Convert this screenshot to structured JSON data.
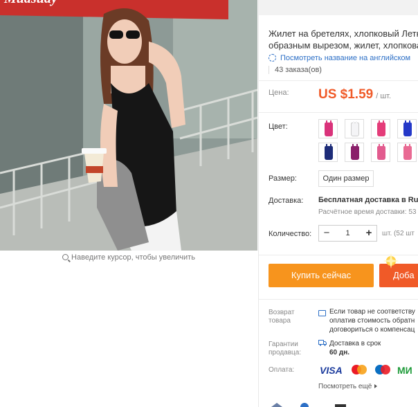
{
  "product_image": {
    "watermark": "Mudsuay",
    "zoom_hint": "Наведите курсор, чтобы увеличить"
  },
  "product": {
    "title_line1": "Жилет на бретелях, хлопковый Летн",
    "title_line2": "образным вырезом, жилет, хлопкова",
    "translate_link": "Посмотреть название на английском",
    "orders": "43 заказа(ов)"
  },
  "price": {
    "label": "Цена:",
    "value": "US $1.59",
    "unit": "/ шт."
  },
  "color": {
    "label": "Цвет:",
    "options": [
      {
        "name": "rose",
        "color": "#d9327a"
      },
      {
        "name": "white",
        "color": "#f4f4f6"
      },
      {
        "name": "pink-red",
        "color": "#e43c79"
      },
      {
        "name": "blue",
        "color": "#2438c8"
      },
      {
        "name": "navy",
        "color": "#1d2c78"
      },
      {
        "name": "purple",
        "color": "#8a1f6a"
      },
      {
        "name": "pink",
        "color": "#e25b8e"
      },
      {
        "name": "light-pink",
        "color": "#e96a93"
      }
    ]
  },
  "size": {
    "label": "Размер:",
    "value": "Один размер"
  },
  "shipping": {
    "label": "Доставка:",
    "free": "Бесплатная доставка в Russ",
    "time": "Расчётное время доставки: 53"
  },
  "quantity": {
    "label": "Количество:",
    "value": "1",
    "minus": "−",
    "plus": "+",
    "note": "шт. (52 шт"
  },
  "actions": {
    "buy_now": "Купить сейчас",
    "add_to_cart": "Доба"
  },
  "returns": {
    "label_line1": "Возврат",
    "label_line2": "товара",
    "text_line1": "Если товар не соответству",
    "text_line2": "оплатив стоимость обратн",
    "text_line3": "договориться о компенсац"
  },
  "guarantee": {
    "label_line1": "Гарантии",
    "label_line2": "продавца:",
    "text_line1": "Доставка в срок",
    "text_line2": "60 дн."
  },
  "payment": {
    "label": "Оплата:",
    "visa": "VISA",
    "mir": "МИ",
    "more": "Посмотреть ещё"
  },
  "colors": {
    "accent_orange": "#f7941d",
    "accent_red": "#f05a28",
    "link_blue": "#2c6fc6"
  }
}
